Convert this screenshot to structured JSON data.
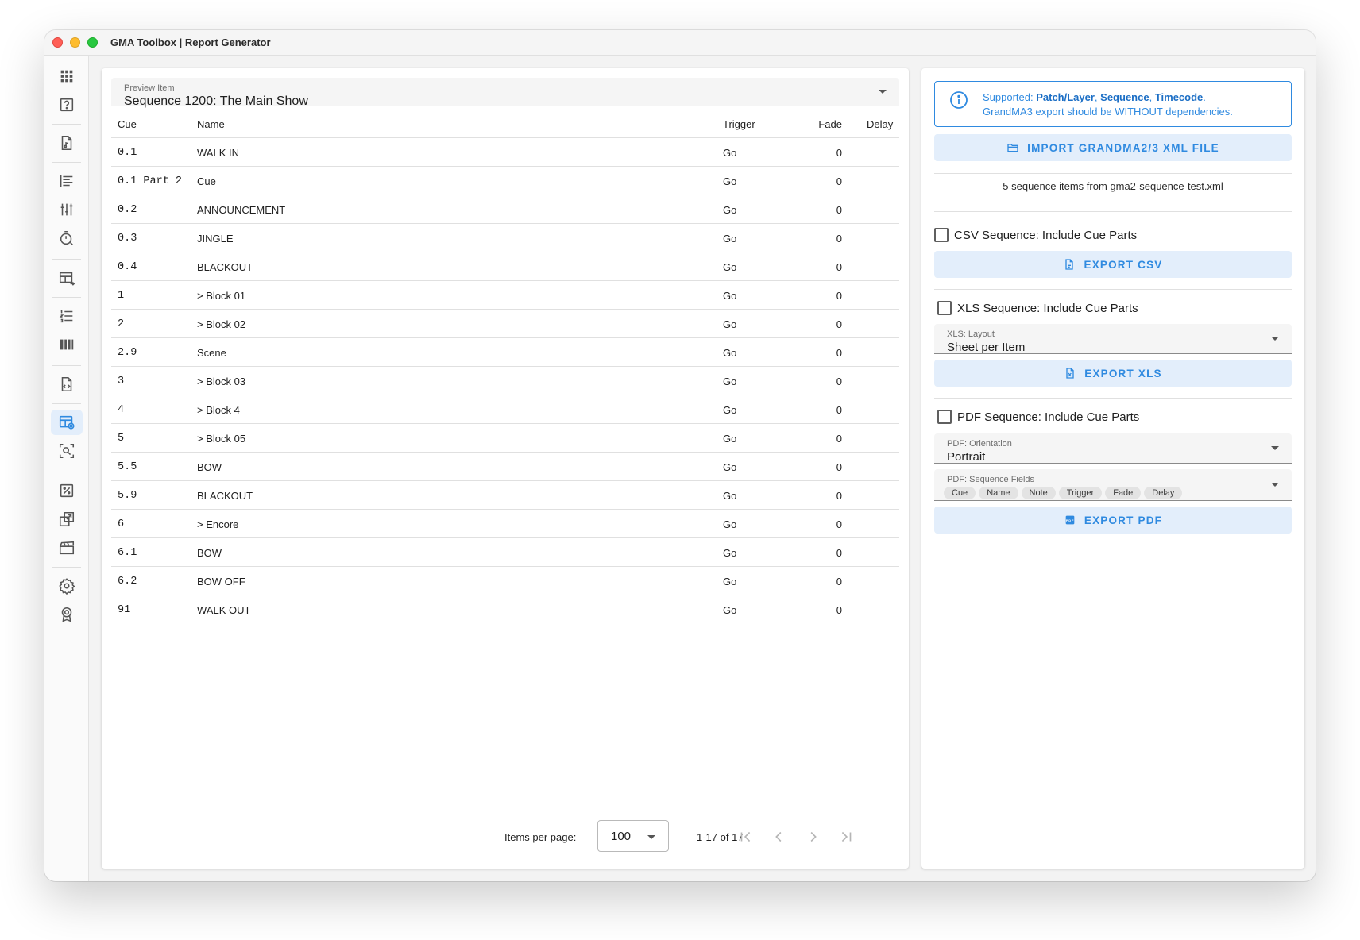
{
  "window": {
    "title": "GMA Toolbox | Report Generator"
  },
  "sidebar": {
    "icons": [
      "apps-icon",
      "help-icon",
      "file-music-icon",
      "align-left-icon",
      "sliders-icon",
      "timer-icon",
      "table-arrow-icon",
      "list-numbered-icon",
      "columns-icon",
      "file-code-icon",
      "table-eye-icon",
      "scan-search-icon",
      "percent-box-icon",
      "export-box-icon",
      "clapperboard-icon",
      "gear-icon",
      "award-icon"
    ],
    "active": "table-eye-icon"
  },
  "preview": {
    "label": "Preview Item",
    "value": "Sequence 1200: The Main Show"
  },
  "table": {
    "headers": {
      "cue": "Cue",
      "name": "Name",
      "trigger": "Trigger",
      "fade": "Fade",
      "delay": "Delay"
    },
    "rows": [
      {
        "cue": "0.1",
        "name": "WALK IN",
        "trigger": "Go",
        "fade": "0",
        "delay": ""
      },
      {
        "cue": "0.1 Part 2",
        "name": "Cue",
        "trigger": "Go",
        "fade": "0",
        "delay": ""
      },
      {
        "cue": "0.2",
        "name": "ANNOUNCEMENT",
        "trigger": "Go",
        "fade": "0",
        "delay": ""
      },
      {
        "cue": "0.3",
        "name": "JINGLE",
        "trigger": "Go",
        "fade": "0",
        "delay": ""
      },
      {
        "cue": "0.4",
        "name": "BLACKOUT",
        "trigger": "Go",
        "fade": "0",
        "delay": ""
      },
      {
        "cue": "1",
        "name": "> Block 01",
        "trigger": "Go",
        "fade": "0",
        "delay": ""
      },
      {
        "cue": "2",
        "name": "> Block 02",
        "trigger": "Go",
        "fade": "0",
        "delay": ""
      },
      {
        "cue": "2.9",
        "name": "Scene",
        "trigger": "Go",
        "fade": "0",
        "delay": ""
      },
      {
        "cue": "3",
        "name": "> Block 03",
        "trigger": "Go",
        "fade": "0",
        "delay": ""
      },
      {
        "cue": "4",
        "name": "> Block 4",
        "trigger": "Go",
        "fade": "0",
        "delay": ""
      },
      {
        "cue": "5",
        "name": "> Block 05",
        "trigger": "Go",
        "fade": "0",
        "delay": ""
      },
      {
        "cue": "5.5",
        "name": "BOW",
        "trigger": "Go",
        "fade": "0",
        "delay": ""
      },
      {
        "cue": "5.9",
        "name": "BLACKOUT",
        "trigger": "Go",
        "fade": "0",
        "delay": ""
      },
      {
        "cue": "6",
        "name": "> Encore",
        "trigger": "Go",
        "fade": "0",
        "delay": ""
      },
      {
        "cue": "6.1",
        "name": "BOW",
        "trigger": "Go",
        "fade": "0",
        "delay": ""
      },
      {
        "cue": "6.2",
        "name": "BOW OFF",
        "trigger": "Go",
        "fade": "0",
        "delay": ""
      },
      {
        "cue": "91",
        "name": "WALK OUT",
        "trigger": "Go",
        "fade": "0",
        "delay": ""
      }
    ]
  },
  "pagination": {
    "label": "Items per page:",
    "per_page": "100",
    "range": "1-17 of 17"
  },
  "info": {
    "prefix": "Supported: ",
    "item1": "Patch/Layer",
    "sep1": ", ",
    "item2": "Sequence",
    "sep2": ", ",
    "item3": "Timecode",
    "suffix": ".",
    "line2": "GrandMA3 export should be WITHOUT dependencies."
  },
  "import_button": "IMPORT GRANDMA2/3 XML FILE",
  "source_text": "5 sequence items from gma2-sequence-test.xml",
  "csv": {
    "checkbox": "CSV Sequence: Include Cue Parts",
    "button": "EXPORT CSV"
  },
  "xls": {
    "checkbox": "XLS Sequence: Include Cue Parts",
    "layout_label": "XLS: Layout",
    "layout_value": "Sheet per Item",
    "button": "EXPORT XLS"
  },
  "pdf": {
    "checkbox": "PDF Sequence: Include Cue Parts",
    "orientation_label": "PDF: Orientation",
    "orientation_value": "Portrait",
    "fields_label": "PDF: Sequence Fields",
    "fields": [
      "Cue",
      "Name",
      "Note",
      "Trigger",
      "Fade",
      "Delay"
    ],
    "button": "EXPORT PDF"
  },
  "colors": {
    "accent": "#2f8ae0",
    "button_bg": "#e3eefb",
    "window_bg": "#f3f3f3"
  }
}
